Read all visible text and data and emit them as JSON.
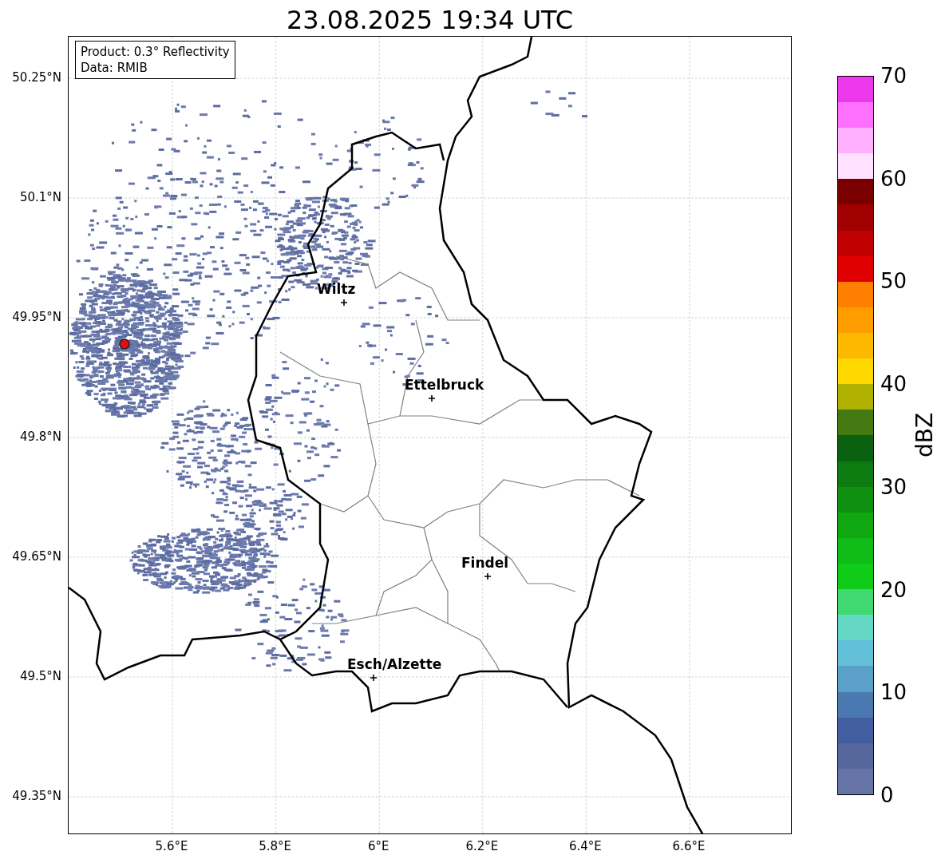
{
  "title": "23.08.2025 19:34 UTC",
  "legend": [
    "Product: 0.3° Reflectivity",
    "Data: RMIB"
  ],
  "map": {
    "lat_ticks": [
      "50.25°N",
      "50.1°N",
      "49.95°N",
      "49.8°N",
      "49.65°N",
      "49.5°N",
      "49.35°N"
    ],
    "lon_ticks": [
      "5.6°E",
      "5.8°E",
      "6°E",
      "6.2°E",
      "6.4°E",
      "6.6°E"
    ],
    "cities": [
      {
        "name": "Wiltz"
      },
      {
        "name": "Ettelbruck"
      },
      {
        "name": "Findel"
      },
      {
        "name": "Esch/Alzette"
      }
    ]
  },
  "colorbar": {
    "label": "dBZ",
    "ticks": [
      "70",
      "60",
      "50",
      "40",
      "30",
      "20",
      "10",
      "0"
    ],
    "segments": [
      {
        "color": "#6674a6"
      },
      {
        "color": "#56679e"
      },
      {
        "color": "#435ea0"
      },
      {
        "color": "#4a78b0"
      },
      {
        "color": "#5aa0c8"
      },
      {
        "color": "#64c0d8"
      },
      {
        "color": "#64d8c4"
      },
      {
        "color": "#40d870"
      },
      {
        "color": "#10cc18"
      },
      {
        "color": "#10bc18"
      },
      {
        "color": "#10a810"
      },
      {
        "color": "#109010"
      },
      {
        "color": "#0c7c10"
      },
      {
        "color": "#0a6210"
      },
      {
        "color": "#447810"
      },
      {
        "color": "#b0b000"
      },
      {
        "color": "#ffd800"
      },
      {
        "color": "#ffb800"
      },
      {
        "color": "#ff9c00"
      },
      {
        "color": "#ff8000"
      },
      {
        "color": "#e00000"
      },
      {
        "color": "#c00000"
      },
      {
        "color": "#a00000"
      },
      {
        "color": "#7a0000"
      },
      {
        "color": "#ffe0ff"
      },
      {
        "color": "#ffb0ff"
      },
      {
        "color": "#ff70ff"
      },
      {
        "color": "#ee38ee"
      }
    ]
  }
}
